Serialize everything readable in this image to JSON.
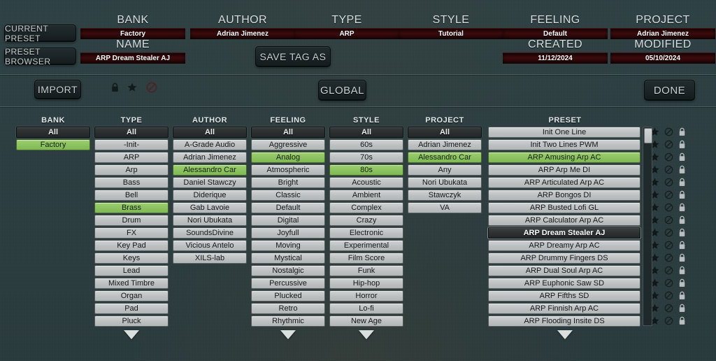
{
  "header": {
    "buttons": {
      "current_preset": "CURRENT PRESET",
      "preset_browser": "PRESET BROWSER",
      "save_tag_as": "SAVE TAG AS"
    },
    "fields": [
      {
        "label": "BANK",
        "value": "Factory"
      },
      {
        "label": "AUTHOR",
        "value": "Adrian Jimenez"
      },
      {
        "label": "TYPE",
        "value": "ARP"
      },
      {
        "label": "STYLE",
        "value": "Tutorial"
      },
      {
        "label": "FEELING",
        "value": "Default"
      },
      {
        "label": "PROJECT",
        "value": "Adrian Jimenez"
      }
    ],
    "name": {
      "label": "NAME",
      "value": "ARP Dream Stealer AJ"
    },
    "created": {
      "label": "CREATED",
      "value": "11/12/2024"
    },
    "modified": {
      "label": "MODIFIED",
      "value": "05/10/2024"
    }
  },
  "toolbar": {
    "import": "IMPORT",
    "global": "GLOBAL",
    "done": "DONE",
    "icons": [
      {
        "name": "lock-icon",
        "title": "lock"
      },
      {
        "name": "star-icon",
        "title": "favorite"
      },
      {
        "name": "prohibited-icon",
        "title": "disabled"
      }
    ]
  },
  "colors": {
    "background": "#2b3d40",
    "selected_green": "#8cc25f",
    "active_dark": "#2c3031",
    "cell_gray": "#bcc0c1",
    "value_field_red": "#3c0c0e"
  },
  "columns": [
    {
      "title": "BANK",
      "all_label": "All",
      "has_arrow": false,
      "items": [
        {
          "label": "Factory",
          "state": "selected"
        }
      ]
    },
    {
      "title": "TYPE",
      "all_label": "All",
      "has_arrow": true,
      "items": [
        {
          "label": "-Init-",
          "state": "normal"
        },
        {
          "label": "ARP",
          "state": "normal"
        },
        {
          "label": "Arp",
          "state": "normal"
        },
        {
          "label": "Bass",
          "state": "normal"
        },
        {
          "label": "Bell",
          "state": "normal"
        },
        {
          "label": "Brass",
          "state": "selected"
        },
        {
          "label": "Drum",
          "state": "normal"
        },
        {
          "label": "FX",
          "state": "normal"
        },
        {
          "label": "Key Pad",
          "state": "normal"
        },
        {
          "label": "Keys",
          "state": "normal"
        },
        {
          "label": "Lead",
          "state": "normal"
        },
        {
          "label": "Mixed Timbre",
          "state": "normal"
        },
        {
          "label": "Organ",
          "state": "normal"
        },
        {
          "label": "Pad",
          "state": "normal"
        },
        {
          "label": "Pluck",
          "state": "normal"
        }
      ]
    },
    {
      "title": "AUTHOR",
      "all_label": "All",
      "has_arrow": false,
      "items": [
        {
          "label": "A-Grade Audio",
          "state": "normal"
        },
        {
          "label": "Adrian Jimenez",
          "state": "normal"
        },
        {
          "label": "Alessandro Car",
          "state": "selected"
        },
        {
          "label": "Daniel Stawczy",
          "state": "normal"
        },
        {
          "label": "Diderique",
          "state": "normal"
        },
        {
          "label": "Gab Lavoie",
          "state": "normal"
        },
        {
          "label": "Nori Ubukata",
          "state": "normal"
        },
        {
          "label": "SoundsDivine",
          "state": "normal"
        },
        {
          "label": "Vicious Antelo",
          "state": "normal"
        },
        {
          "label": "XILS-lab",
          "state": "normal"
        }
      ]
    },
    {
      "title": "FEELING",
      "all_label": "All",
      "has_arrow": true,
      "items": [
        {
          "label": "Aggressive",
          "state": "normal"
        },
        {
          "label": "Analog",
          "state": "selected"
        },
        {
          "label": "Atmospheric",
          "state": "normal"
        },
        {
          "label": "Bright",
          "state": "normal"
        },
        {
          "label": "Classic",
          "state": "normal"
        },
        {
          "label": "Default",
          "state": "normal"
        },
        {
          "label": "Digital",
          "state": "normal"
        },
        {
          "label": "Joyfull",
          "state": "normal"
        },
        {
          "label": "Moving",
          "state": "normal"
        },
        {
          "label": "Mystical",
          "state": "normal"
        },
        {
          "label": "Nostalgic",
          "state": "normal"
        },
        {
          "label": "Percussive",
          "state": "normal"
        },
        {
          "label": "Plucked",
          "state": "normal"
        },
        {
          "label": "Retro",
          "state": "normal"
        },
        {
          "label": "Rhythmic",
          "state": "normal"
        }
      ]
    },
    {
      "title": "STYLE",
      "all_label": "All",
      "has_arrow": true,
      "items": [
        {
          "label": "60s",
          "state": "normal"
        },
        {
          "label": "70s",
          "state": "normal"
        },
        {
          "label": "80s",
          "state": "selected"
        },
        {
          "label": "Acoustic",
          "state": "normal"
        },
        {
          "label": "Ambient",
          "state": "normal"
        },
        {
          "label": "Complex",
          "state": "normal"
        },
        {
          "label": "Crazy",
          "state": "normal"
        },
        {
          "label": "Electronic",
          "state": "normal"
        },
        {
          "label": "Experimental",
          "state": "normal"
        },
        {
          "label": "Film Score",
          "state": "normal"
        },
        {
          "label": "Funk",
          "state": "normal"
        },
        {
          "label": "Hip-hop",
          "state": "normal"
        },
        {
          "label": "Horror",
          "state": "normal"
        },
        {
          "label": "Lo-fi",
          "state": "normal"
        },
        {
          "label": "New Age",
          "state": "normal"
        }
      ]
    },
    {
      "title": "PROJECT",
      "all_label": "All",
      "has_arrow": false,
      "items": [
        {
          "label": "Adrian Jimenez",
          "state": "normal"
        },
        {
          "label": "Alessandro Car",
          "state": "selected"
        },
        {
          "label": "Any",
          "state": "normal"
        },
        {
          "label": "Nori Ubukata",
          "state": "normal"
        },
        {
          "label": "Stawczyk",
          "state": "normal"
        },
        {
          "label": "VA",
          "state": "normal"
        }
      ]
    }
  ],
  "preset_column": {
    "title": "PRESET",
    "has_arrow": true,
    "row_icons": [
      "star-icon",
      "prohibited-icon",
      "lock-icon"
    ],
    "scrollbar": {
      "thumb_top_pct": 0,
      "thumb_height_pct": 7
    },
    "items": [
      {
        "label": "Init One Line",
        "state": "normal"
      },
      {
        "label": "Init Two Lines PWM",
        "state": "normal"
      },
      {
        "label": "ARP Amusing Arp AC",
        "state": "selected"
      },
      {
        "label": "ARP Arp Me DI",
        "state": "normal"
      },
      {
        "label": "ARP Articulated Arp AC",
        "state": "normal"
      },
      {
        "label": "ARP Bongos DI",
        "state": "normal"
      },
      {
        "label": "ARP Busted Lofi GL",
        "state": "normal"
      },
      {
        "label": "ARP Calculator Arp AC",
        "state": "normal"
      },
      {
        "label": "ARP Dream Stealer AJ",
        "state": "active"
      },
      {
        "label": "ARP Dreamy Arp AC",
        "state": "normal"
      },
      {
        "label": "ARP Drummy Fingers DS",
        "state": "normal"
      },
      {
        "label": "ARP Dual Soul Arp AC",
        "state": "normal"
      },
      {
        "label": "ARP Euphonic Saw SD",
        "state": "normal"
      },
      {
        "label": "ARP Fifths SD",
        "state": "normal"
      },
      {
        "label": "ARP Finnish Arp AC",
        "state": "normal"
      },
      {
        "label": "ARP Flooding Insite DS",
        "state": "normal"
      }
    ]
  }
}
